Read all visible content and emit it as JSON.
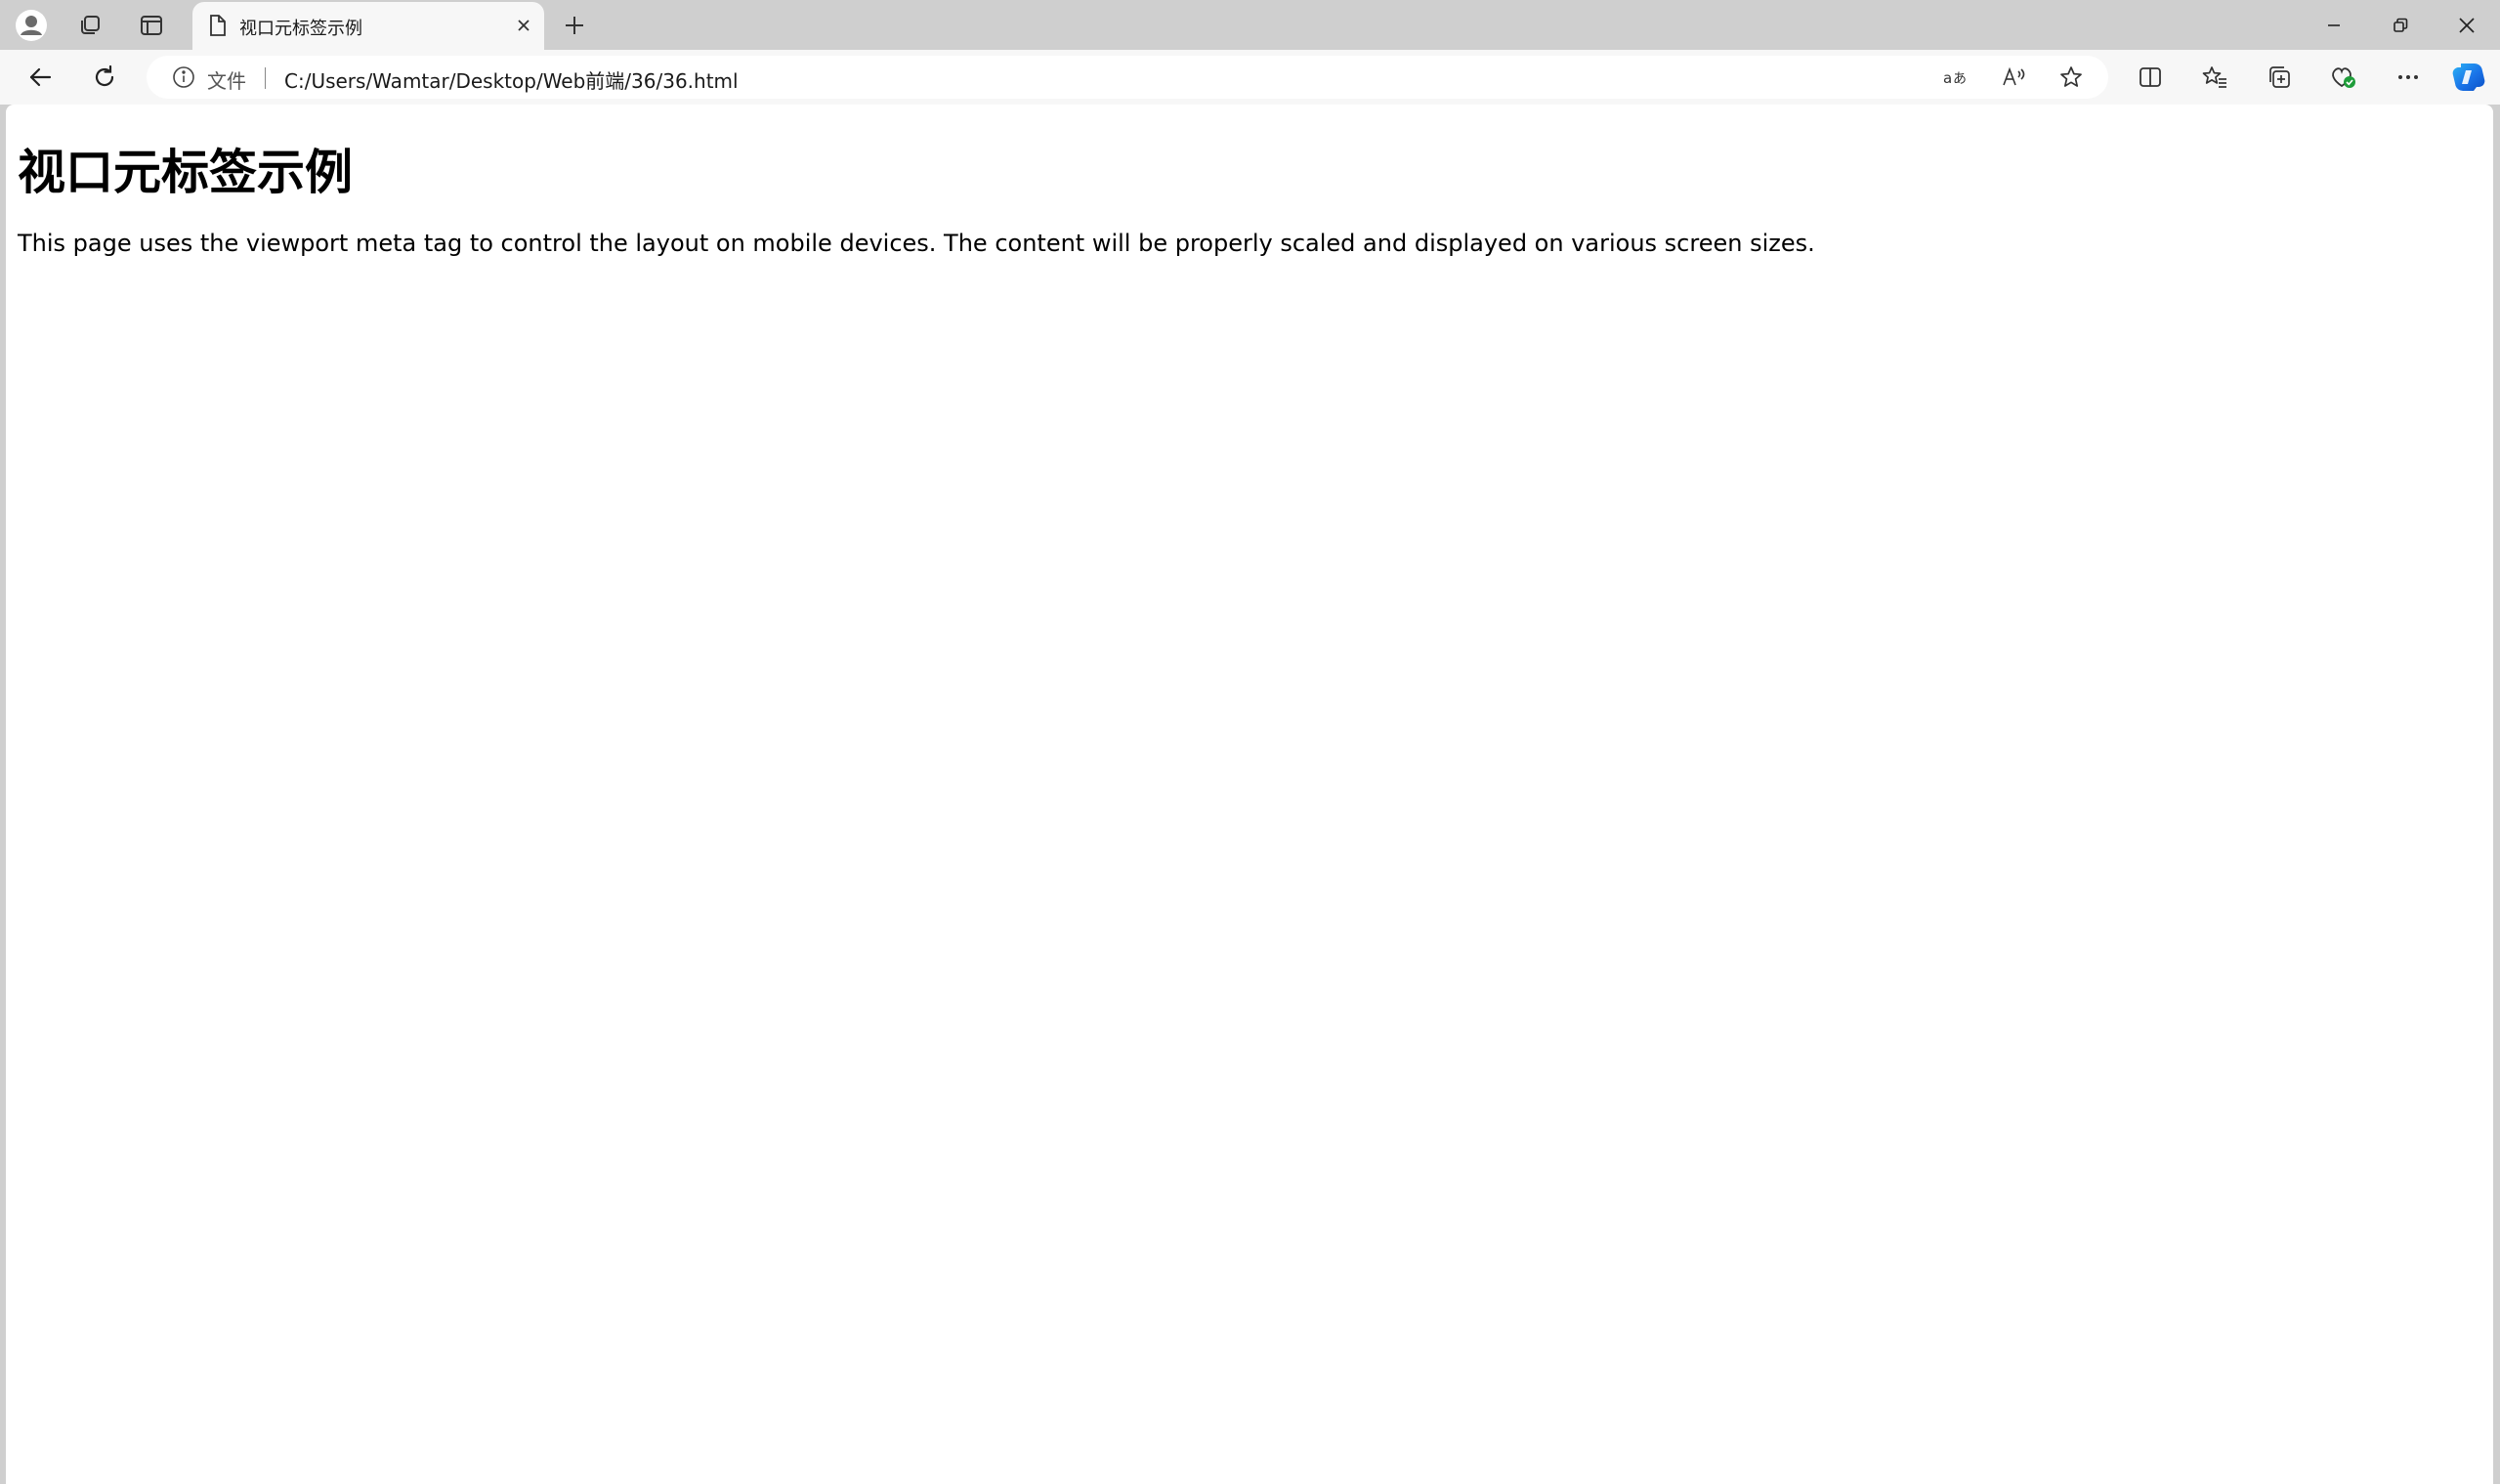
{
  "browser": {
    "tab": {
      "title": "视口元标签示例"
    },
    "address_bar": {
      "scheme_chip": "文件",
      "url": "C:/Users/Wamtar/Desktop/Web前端/36/36.html"
    },
    "icons": {
      "profile": "profile-icon",
      "workspaces": "workspaces-icon",
      "vertical_tabs": "vertical-tabs-icon",
      "page": "document-icon",
      "close_tab": "close-icon",
      "new_tab": "plus-icon",
      "minimize": "minimize-icon",
      "restore": "restore-icon",
      "close_window": "close-icon",
      "back": "back-arrow-icon",
      "refresh": "refresh-icon",
      "info": "info-icon",
      "translate": "translate-icon",
      "read_aloud": "read-aloud-icon",
      "favorite": "star-icon",
      "split_screen": "split-screen-icon",
      "favorites": "favorites-icon",
      "collections": "collections-icon",
      "browser_essentials": "browser-essentials-icon",
      "more": "more-icon",
      "copilot": "copilot-icon"
    }
  },
  "page": {
    "heading": "视口元标签示例",
    "paragraph": "This page uses the viewport meta tag to control the layout on mobile devices. The content will be properly scaled and displayed on various screen sizes."
  },
  "colors": {
    "frame": "#cfcfcf",
    "toolbar": "#f7f7f7",
    "page_background": "#ffffff",
    "copilot_blue": "#1a73e8",
    "essentials_green": "#1f9d3a"
  }
}
